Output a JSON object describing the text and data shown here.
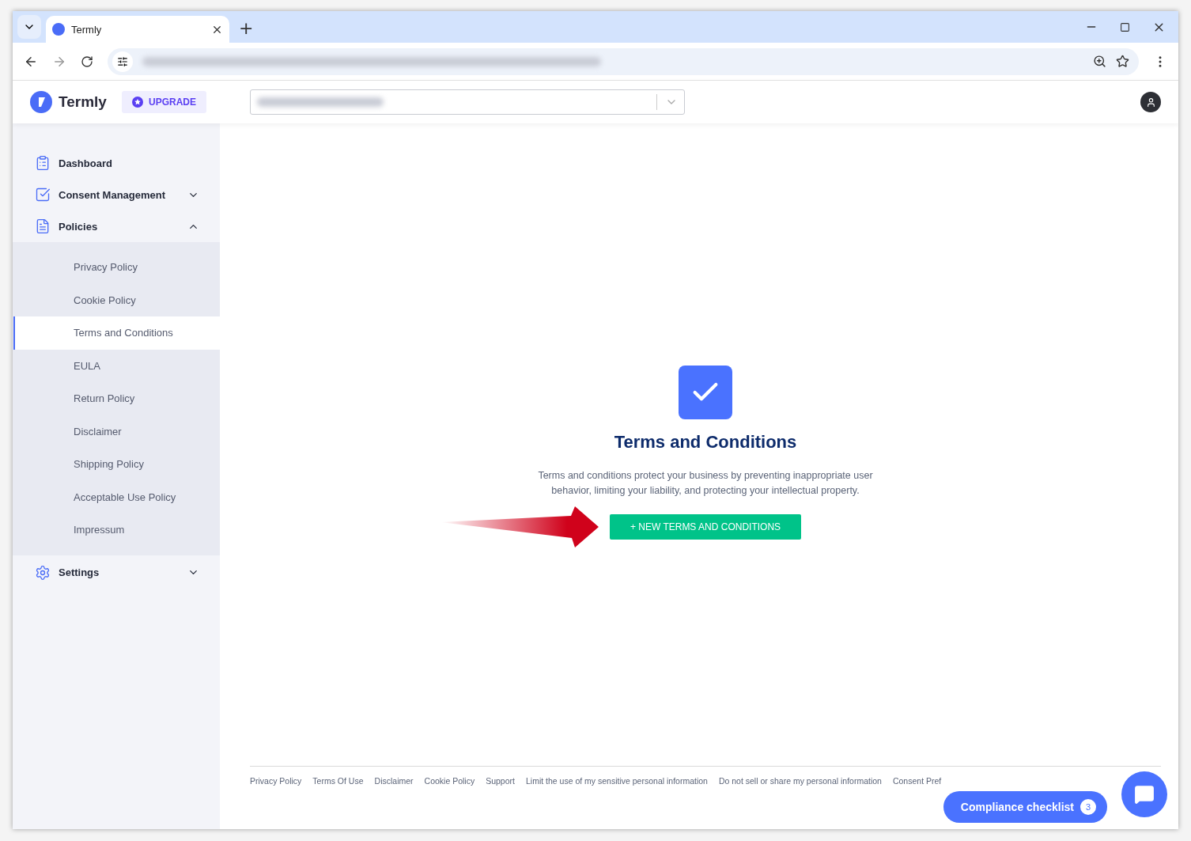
{
  "browser": {
    "tab_title": "Termly",
    "new_tab": "+"
  },
  "header": {
    "logo": "Termly",
    "upgrade": "UPGRADE"
  },
  "sidebar": {
    "items": [
      {
        "label": "Dashboard",
        "kind": "dashboard"
      },
      {
        "label": "Consent Management",
        "kind": "consent",
        "expanded": false
      },
      {
        "label": "Policies",
        "kind": "policies",
        "expanded": true,
        "children": [
          {
            "label": "Privacy Policy",
            "selected": false
          },
          {
            "label": "Cookie Policy",
            "selected": false
          },
          {
            "label": "Terms and Conditions",
            "selected": true
          },
          {
            "label": "EULA",
            "selected": false
          },
          {
            "label": "Return Policy",
            "selected": false
          },
          {
            "label": "Disclaimer",
            "selected": false
          },
          {
            "label": "Shipping Policy",
            "selected": false
          },
          {
            "label": "Acceptable Use Policy",
            "selected": false
          },
          {
            "label": "Impressum",
            "selected": false
          }
        ]
      },
      {
        "label": "Settings",
        "kind": "settings",
        "expanded": false
      }
    ]
  },
  "main": {
    "title": "Terms and Conditions",
    "description": "Terms and conditions protect your business by preventing inappropriate user behavior, limiting your liability, and protecting your intellectual property.",
    "button": "+ NEW TERMS AND CONDITIONS"
  },
  "footer": {
    "links": [
      "Privacy Policy",
      "Terms Of Use",
      "Disclaimer",
      "Cookie Policy",
      "Support",
      "Limit the use of my sensitive personal information",
      "Do not sell or share my personal information",
      "Consent Pref"
    ]
  },
  "compliance": {
    "label": "Compliance checklist",
    "count": "3"
  }
}
